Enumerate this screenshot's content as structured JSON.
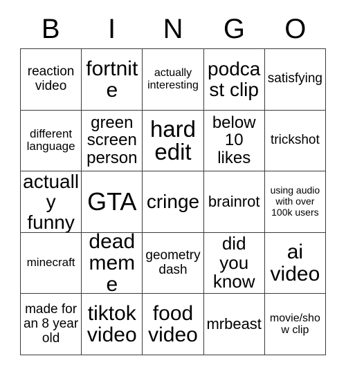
{
  "card": {
    "title": "BINGO",
    "header_letters": [
      "B",
      "I",
      "N",
      "G",
      "O"
    ],
    "colors": {
      "background": "#ffffff",
      "text": "#000000",
      "grid_line": "#3a3a3a"
    },
    "grid_size": "5x5",
    "rows": [
      [
        {
          "text": "reaction video",
          "size": "md"
        },
        {
          "text": "fortnite",
          "size": "4xl"
        },
        {
          "text": "actually interesting",
          "size": "sm"
        },
        {
          "text": "podcast clip",
          "size": "3xl"
        },
        {
          "text": "satisfying",
          "size": "md"
        }
      ],
      [
        {
          "text": "different language",
          "size": "smd"
        },
        {
          "text": "green screen person",
          "size": "xl"
        },
        {
          "text": "hard edit",
          "size": "5xl"
        },
        {
          "text": "below 10 likes",
          "size": "xl"
        },
        {
          "text": "trickshot",
          "size": "md"
        }
      ],
      [
        {
          "text": "actually funny",
          "size": "3xl"
        },
        {
          "text": "GTA",
          "size": "6xl"
        },
        {
          "text": "cringe",
          "size": "3xl"
        },
        {
          "text": "brainrot",
          "size": "lg"
        },
        {
          "text": "using audio with over 100k users",
          "size": "xs"
        }
      ],
      [
        {
          "text": "minecraft",
          "size": "smd"
        },
        {
          "text": "dead meme",
          "size": "4xl"
        },
        {
          "text": "geometry dash",
          "size": "md"
        },
        {
          "text": "did you know",
          "size": "2xl"
        },
        {
          "text": "ai video",
          "size": "4xl"
        }
      ],
      [
        {
          "text": "made for an 8 year old",
          "size": "md"
        },
        {
          "text": "tiktok video",
          "size": "4xl"
        },
        {
          "text": "food video",
          "size": "4xl"
        },
        {
          "text": "mrbeast",
          "size": "lg"
        },
        {
          "text": "movie/show clip",
          "size": "sm"
        }
      ]
    ]
  }
}
